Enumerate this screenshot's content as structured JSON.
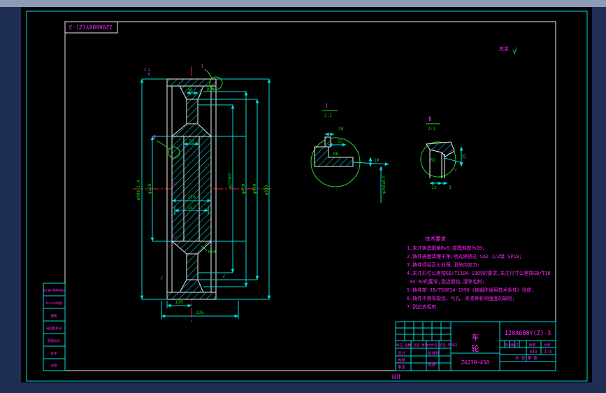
{
  "colors": {
    "top_bar": "#8c9cb4",
    "outer_background": "#1f2e55",
    "canvas_background": "#000000",
    "frame_cyan": "#00dcdc",
    "sheet_white": "#ececec",
    "dim_text_green": "#00e000",
    "annotation_magenta": "#ff26ff",
    "centerline_red": "#ff2020",
    "detail_circle_green": "#2bd62b"
  },
  "corner_stamp": "120A608Y(Z)-3",
  "surface_mark": {
    "prefix": "其余",
    "symbol": "√"
  },
  "main_view": {
    "dims": {
      "left_outer": "φ900-1.4",
      "left_inner": "φ230",
      "right_1": "φ225H7",
      "right_2": "φ410",
      "right_3": "φ430",
      "right_4": "φ830",
      "web": "30",
      "fillet_top": "R10",
      "bore": "50",
      "hub_len": "170",
      "hub_inner": "157",
      "tread_half": "120",
      "overall": "235",
      "fillet_hub": "R50",
      "chamfer": "C2"
    },
    "marker_1": "Ⅰ",
    "marker_2": "Ⅱ",
    "rough_a": "3.2",
    "rough_check": "√"
  },
  "details": {
    "d1": {
      "label": "Ⅰ",
      "scale": "2:1",
      "dim_top": "10",
      "dim_width": "15",
      "radius": "R6",
      "dim_right": "10",
      "diameter": "φ250±0.5"
    },
    "d2": {
      "label": "Ⅱ",
      "scale": "2:1",
      "dim_a": "13",
      "dim_b": "3",
      "dim_right": "15",
      "radius": "R2"
    }
  },
  "notes": {
    "title": "技术要求",
    "lines": [
      "1.未注铸造圆角R=5,拔模斜度为20;",
      "2.铸件表面清理干净,喷丸除锈达 Sa2 1/2级 SP10;",
      "3.铸件须经正火处理,消除内应力:",
      "4.未注形位公差按GB/T1184-1989的要求,未注尺寸公差按GB/T18",
      "04-92的要求,锐边倒钝,清除毛刺;",
      "5.铸件按 JB/T50014-1996《铸钢件通用技术条件》验收;",
      "6.铸件不得有裂纹、气孔、夹渣等影响强度的缺陷;",
      "7.锐边去毛刺."
    ]
  },
  "title_block": {
    "drawing_no": "120A608Y(Z)-3",
    "part_name_top": "车",
    "part_name_bottom": "轮",
    "material": "ZG230~450",
    "header_row": "标记 处数 分区 更改文件号 签名 年月日",
    "row_labels": [
      "设计",
      "校核",
      "审定",
      "工艺"
    ],
    "mid_labels": [
      "标准化",
      "批准"
    ],
    "stage_label": "阶段标记",
    "mass_label": "质量",
    "scale_label": "比例",
    "mass_value": "443",
    "scale_value": "1:4",
    "sheet_info": "共 张 第 张"
  },
  "margin_boxes": [
    "借(通)用件登记",
    "AutoCAD图",
    "描图",
    "旧底图总号",
    "底图总号",
    "签字",
    "日期"
  ],
  "footer_label": "设计"
}
